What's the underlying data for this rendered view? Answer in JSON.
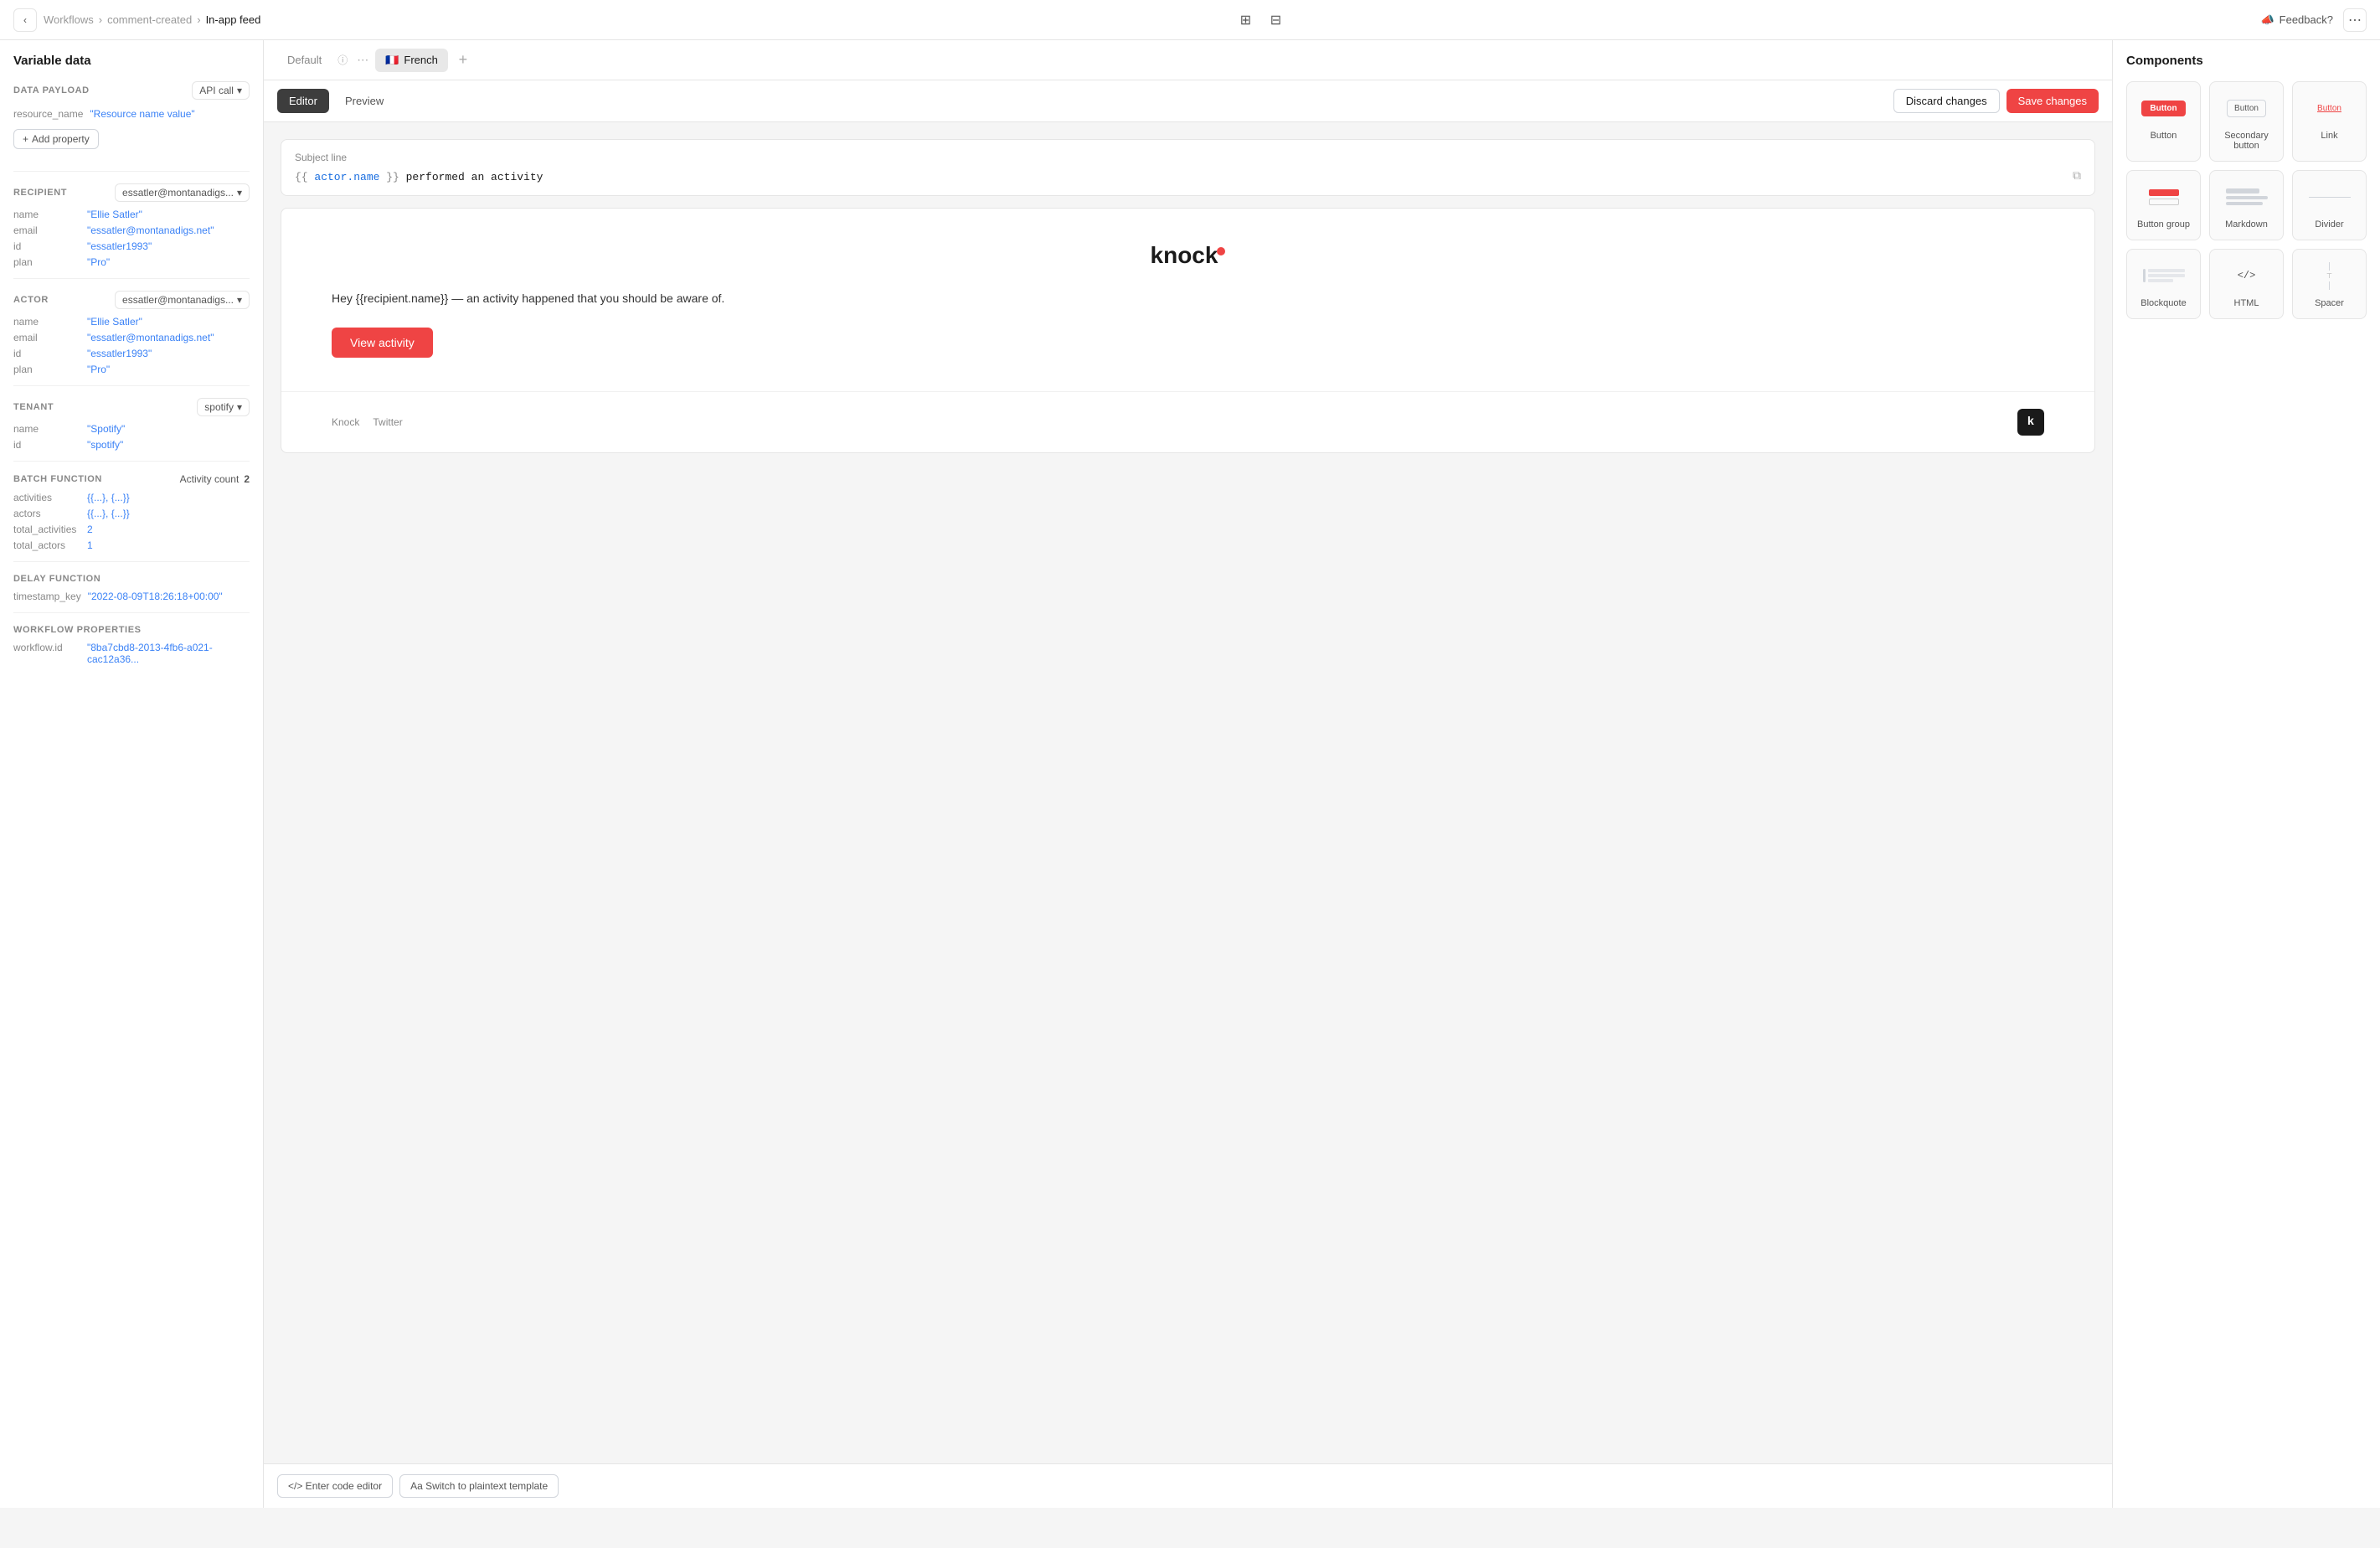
{
  "nav": {
    "breadcrumb": {
      "root": "Workflows",
      "parent": "comment-created",
      "current": "In-app feed"
    },
    "feedback_label": "Feedback?",
    "more_icon": "⋯"
  },
  "left_sidebar": {
    "title": "Variable data",
    "data_payload": {
      "label": "DATA PAYLOAD",
      "dropdown_value": "API call",
      "properties": [
        {
          "key": "resource_name",
          "value": "\"Resource name value\""
        }
      ],
      "add_property_label": "Add property"
    },
    "recipient": {
      "label": "RECIPIENT",
      "dropdown_value": "essatler@montanadigs...",
      "properties": [
        {
          "key": "name",
          "value": "\"Ellie Satler\""
        },
        {
          "key": "email",
          "value": "\"essatler@montanadigs.net\""
        },
        {
          "key": "id",
          "value": "\"essatler1993\""
        },
        {
          "key": "plan",
          "value": "\"Pro\""
        }
      ]
    },
    "actor": {
      "label": "ACTOR",
      "dropdown_value": "essatler@montanadigs...",
      "properties": [
        {
          "key": "name",
          "value": "\"Ellie Satler\""
        },
        {
          "key": "email",
          "value": "\"essatler@montanadigs.net\""
        },
        {
          "key": "id",
          "value": "\"essatler1993\""
        },
        {
          "key": "plan",
          "value": "\"Pro\""
        }
      ]
    },
    "tenant": {
      "label": "TENANT",
      "dropdown_value": "spotify",
      "properties": [
        {
          "key": "name",
          "value": "\"Spotify\""
        },
        {
          "key": "id",
          "value": "\"spotify\""
        }
      ]
    },
    "batch_function": {
      "label": "BATCH FUNCTION",
      "count_label": "Activity count",
      "count_value": "2",
      "properties": [
        {
          "key": "activities",
          "value": "{{...}, {...}}"
        },
        {
          "key": "actors",
          "value": "{{...}, {...}}"
        },
        {
          "key": "total_activities",
          "value": "2"
        },
        {
          "key": "total_actors",
          "value": "1"
        }
      ]
    },
    "delay_function": {
      "label": "DELAY FUNCTION",
      "properties": [
        {
          "key": "timestamp_key",
          "value": "\"2022-08-09T18:26:18+00:00\""
        }
      ]
    },
    "workflow_properties": {
      "label": "WORKFLOW PROPERTIES",
      "properties": [
        {
          "key": "workflow.id",
          "value": "\"8ba7cbd8-2013-4fb6-a021-cac12a36..."
        }
      ]
    }
  },
  "tabs": {
    "default_label": "Default",
    "french_label": "French",
    "french_flag": "🇫🇷",
    "add_icon": "+"
  },
  "toolbar": {
    "editor_label": "Editor",
    "preview_label": "Preview",
    "discard_label": "Discard changes",
    "save_label": "Save changes"
  },
  "editor": {
    "subject_label": "Subject line",
    "subject_value": "{{ actor.name }} performed an activity",
    "email_body": {
      "logo_text": "knock",
      "greeting": "Hey {{recipient.name}} — an activity happened that you should be aware of.",
      "button_label": "View activity",
      "footer_link1": "Knock",
      "footer_link2": "Twitter",
      "footer_logo": "k"
    },
    "code_editor_label": "</>  Enter code editor",
    "plaintext_label": "Aa Switch to plaintext template"
  },
  "components": {
    "title": "Components",
    "items": [
      {
        "id": "button",
        "label": "Button",
        "type": "button-red"
      },
      {
        "id": "secondary-button",
        "label": "Secondary button",
        "type": "button-outline"
      },
      {
        "id": "link",
        "label": "Link",
        "type": "button-link"
      },
      {
        "id": "button-group",
        "label": "Button group",
        "type": "button-group"
      },
      {
        "id": "markdown",
        "label": "Markdown",
        "type": "markdown"
      },
      {
        "id": "divider",
        "label": "Divider",
        "type": "divider"
      },
      {
        "id": "blockquote",
        "label": "Blockquote",
        "type": "blockquote"
      },
      {
        "id": "html",
        "label": "HTML",
        "type": "html"
      },
      {
        "id": "spacer",
        "label": "Spacer",
        "type": "spacer"
      }
    ]
  }
}
